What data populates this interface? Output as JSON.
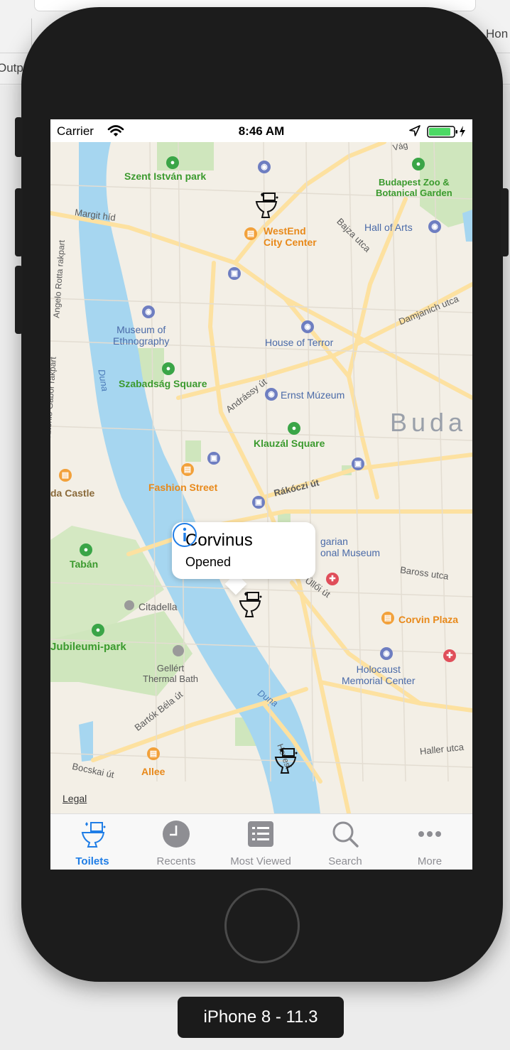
{
  "window": {
    "left_fragment": "Outp",
    "right_fragment": "Hon"
  },
  "status_bar": {
    "carrier": "Carrier",
    "time": "8:46 AM"
  },
  "map": {
    "labels": {
      "szent_istvan_park": "Szent István park",
      "budapest_zoo": "Budapest Zoo &\nBotanical Garden",
      "margit_hid": "Margit híd",
      "westend": "WestEnd\nCity Center",
      "bajza_utca": "Bajza utca",
      "hall_of_arts": "Hall of Arts",
      "damjanich_utca": "Damjanich utca",
      "museum_of_ethnography": "Museum of\nEthnography",
      "house_of_terror": "House of Terror",
      "szabadsag_square": "Szabadság Square",
      "andrassy_ut": "Andrássy út",
      "ernst_muzeum": "Ernst Múzeum",
      "buda": "Buda",
      "klauzal_square": "Klauzál Square",
      "fashion_street": "Fashion Street",
      "rakoczi_ut": "Rákóczi út",
      "castle": "da Castle",
      "hungarian_museum": "garian\nonal Museum",
      "taban": "Tabán",
      "baross_utca": "Baross utca",
      "ulloi_ut": "Üllői út",
      "citadella": "Citadella",
      "corvin_plaza": "Corvin Plaza",
      "jubileumi_park": "Jubileumi-park",
      "gellert": "Gellért\nThermal Bath",
      "holocaust": "Holocaust\nMemorial Center",
      "duna_1": "Duna",
      "duna_2": "Duna",
      "bartok_bela_ut": "Bartók Béla út",
      "haller_utca": "Haller utca",
      "bocskai_ut": "Bocskai út",
      "allee": "Allee",
      "angelo_rotta": "Angelo Rotta rakpart",
      "szent_gabor": "Sztehlo Gábor rakpart",
      "hevizi": "Hevesi",
      "vag": "Vág"
    },
    "legal": "Legal"
  },
  "callout": {
    "title": "Corvinus",
    "subtitle": "Opened"
  },
  "tabs": [
    {
      "label": "Toilets",
      "icon": "toilet-icon",
      "active": true
    },
    {
      "label": "Recents",
      "icon": "clock-icon",
      "active": false
    },
    {
      "label": "Most Viewed",
      "icon": "list-icon",
      "active": false
    },
    {
      "label": "Search",
      "icon": "search-icon",
      "active": false
    },
    {
      "label": "More",
      "icon": "more-icon",
      "active": false
    }
  ],
  "device": {
    "label": "iPhone 8 - 11.3"
  },
  "colors": {
    "accent": "#1f7de6",
    "water": "#a6d6f0",
    "park": "#c9e4b4",
    "road": "#fde8a8"
  }
}
